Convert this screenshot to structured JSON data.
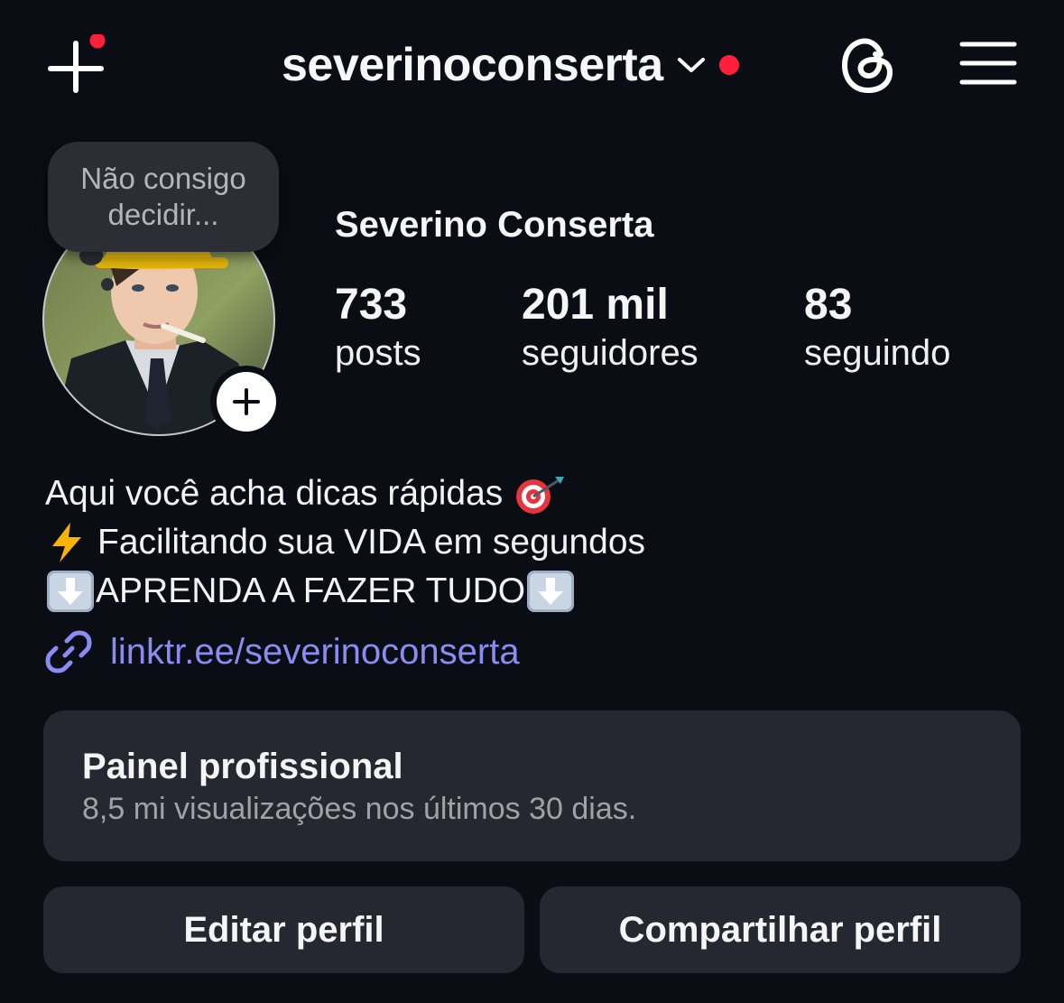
{
  "header": {
    "username": "severinoconserta",
    "new_post_icon": "plus-icon",
    "threads_icon": "threads-icon",
    "menu_icon": "hamburger-menu-icon",
    "notification_color": "#ff1f3a"
  },
  "note": {
    "line1": "Não consigo",
    "line2": "decidir..."
  },
  "profile": {
    "display_name": "Severino Conserta",
    "stats": [
      {
        "value": "733",
        "label": "posts"
      },
      {
        "value": "201 mil",
        "label": "seguidores"
      },
      {
        "value": "83",
        "label": "seguindo"
      }
    ]
  },
  "bio": {
    "line1": "Aqui você acha dicas rápidas",
    "line1_emoji": "direct-hit-emoji",
    "line2_emoji": "high-voltage-emoji",
    "line2": "Facilitando sua VIDA em segundos",
    "line3_emoji_left": "down-arrow-emoji",
    "line3": "APRENDA A FAZER TUDO",
    "line3_emoji_right": "down-arrow-emoji",
    "link_icon": "link-icon",
    "link": "linktr.ee/severinoconserta",
    "link_color": "#8a8cf2"
  },
  "dashboard": {
    "title": "Painel profissional",
    "subtitle": "8,5 mi visualizações nos últimos 30 dias."
  },
  "actions": {
    "edit_label": "Editar perfil",
    "share_label": "Compartilhar perfil"
  }
}
